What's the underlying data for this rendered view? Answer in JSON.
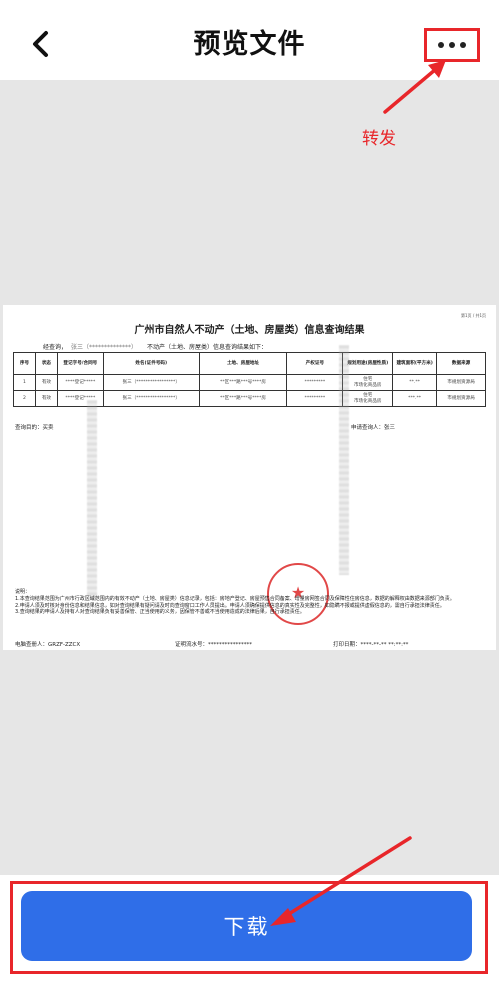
{
  "header": {
    "back_icon": "chevron-left-icon",
    "title": "预览文件",
    "more_icon": "more-horizontal-icon"
  },
  "annotations": {
    "forward_label": "转发",
    "highlight_color": "#e8262a"
  },
  "document": {
    "page_indicator": "第1页 / 共1页",
    "title": "广州市自然人不动产（土地、房屋类）信息查询结果",
    "intro_prefix": "经查询，",
    "intro_name": "张三（**************）",
    "intro_rest": "不动产（土地、房屋类）信息查询结果如下：",
    "columns": [
      "序号",
      "状态",
      "登记字号/合同号",
      "姓名(证件号码)",
      "土地、房屋地址",
      "产权证号",
      "规划用途(房屋性质)",
      "建筑面积(平方米)",
      "数据来源"
    ],
    "rows": [
      [
        "1",
        "有效",
        "****登记*****",
        "张三（*****************）",
        "**区***路***号****房",
        "*********",
        "住宅\n市场化商品房",
        "**.**",
        "市规划资源局"
      ],
      [
        "2",
        "有效",
        "****登记*****",
        "张三（*****************）",
        "**区***路***号****房",
        "*********",
        "住宅\n市场化商品房",
        "***.**",
        "市规划资源局"
      ]
    ],
    "purpose": "查询目的：买卖",
    "applicant": "申请查询人：张三",
    "notes": [
      "说明：",
      "1.本查询结果范围为广州市行政区域范围内的有效不动产（土地、房屋类）信息记录，包括：房地产登记、房屋预售合同备案、增量房网签合同及保障性住房信息，数据的解释权由数据来源部门负责。",
      "2.申请人须及时核对身份信息和结果信息，如对查询结果有疑问请及时向查询窗口工作人员提出。申请人须确保提供信息的真实性及完整性，如隐瞒不报或提供虚假信息的，需自行承担法律责任。",
      "3.查询结果的申请人及持有人对查询结果负有妥善保管、正当使用的义务，因保管不善或不当使用造成的法律后果，自行承担责任。"
    ],
    "operator": "电脑查册人：GRZF-ZZCX",
    "certificate_no": "证明流水号：****************",
    "print_date": "打印日期：****-**-** **:**:**"
  },
  "download": {
    "label": "下载",
    "color": "#2f6ee8"
  }
}
